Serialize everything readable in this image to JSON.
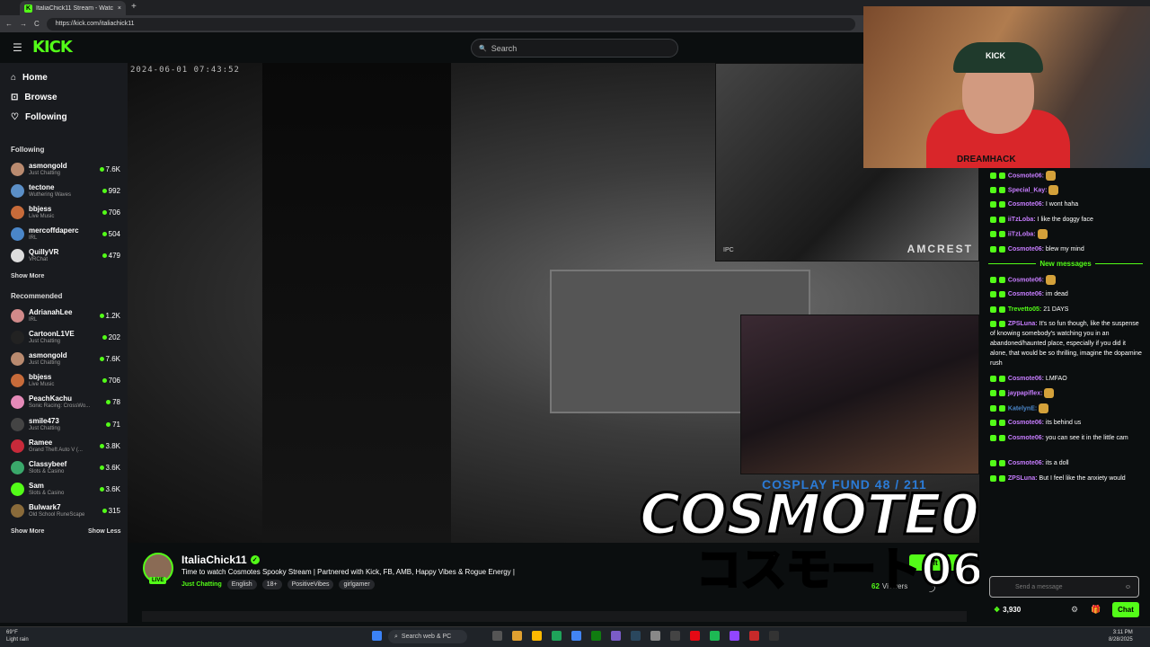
{
  "browser": {
    "tab_title": "ItaliaChick11 Stream - Watc",
    "tab_icon": "K",
    "close": "×",
    "new_tab": "+",
    "back": "←",
    "forward": "→",
    "reload": "C",
    "url": "https://kick.com/italiachick11"
  },
  "header": {
    "logo": "KICK",
    "menu_icon": "☰",
    "search_placeholder": "Search",
    "search_icon": "🔍"
  },
  "sidebar": {
    "nav": [
      {
        "label": "Home",
        "icon": "⌂"
      },
      {
        "label": "Browse",
        "icon": "⊡"
      },
      {
        "label": "Following",
        "icon": "♡"
      }
    ],
    "following_title": "Following",
    "following": [
      {
        "name": "asmongold",
        "category": "Just Chatting",
        "viewers": "7.6K",
        "color": "#b98a6f"
      },
      {
        "name": "tectone",
        "category": "Wuthering Waves",
        "viewers": "992",
        "color": "#5b8fc7"
      },
      {
        "name": "bbjess",
        "category": "Live Music",
        "viewers": "706",
        "color": "#c76b3a"
      },
      {
        "name": "mercoffdaperc",
        "category": "IRL",
        "viewers": "504",
        "color": "#4a86c9"
      },
      {
        "name": "QuillyVR",
        "category": "VRChat",
        "viewers": "479",
        "color": "#dddddd"
      }
    ],
    "show_more_1": "Show More",
    "recommended_title": "Recommended",
    "recommended": [
      {
        "name": "AdrianahLee",
        "category": "IRL",
        "viewers": "1.2K",
        "color": "#d18a8a"
      },
      {
        "name": "CartoonL1VE",
        "category": "Just Chatting",
        "viewers": "202",
        "color": "#222222"
      },
      {
        "name": "asmongold",
        "category": "Just Chatting",
        "viewers": "7.6K",
        "color": "#b98a6f"
      },
      {
        "name": "bbjess",
        "category": "Live Music",
        "viewers": "706",
        "color": "#c76b3a"
      },
      {
        "name": "PeachKachu",
        "category": "Sonic Racing: CrossWo...",
        "viewers": "78",
        "color": "#e48ab8"
      },
      {
        "name": "smile473",
        "category": "Just Chatting",
        "viewers": "71",
        "color": "#444444"
      },
      {
        "name": "Ramee",
        "category": "Grand Theft Auto V (...",
        "viewers": "3.8K",
        "color": "#c72a3a"
      },
      {
        "name": "Classybeef",
        "category": "Slots & Casino",
        "viewers": "3.6K",
        "color": "#3aa86b"
      },
      {
        "name": "Sam",
        "category": "Slots & Casino",
        "viewers": "3.6K",
        "color": "#53fc18"
      },
      {
        "name": "Bulwark7",
        "category": "Old School RuneScape",
        "viewers": "315",
        "color": "#8a6b3a"
      }
    ],
    "show_more_2": "Show More",
    "show_less": "Show Less"
  },
  "video": {
    "timestamp": "2024-06-01    07:43:52",
    "pip_brand": "AMCREST",
    "pip_ip": "IPC",
    "fund": "COSPLAY FUND  48 / 211",
    "overlay_main": "COSMOTE06",
    "overlay_jp": "コスモート06",
    "webcam_cap": "KICK",
    "webcam_shirt": "DREAMHACK"
  },
  "stream": {
    "channel": "ItaliaChick11",
    "verified": "✓",
    "live": "LIVE",
    "title": "Time to watch Cosmotes Spooky Stream | Partnered with Kick, FB, AMB, Happy Vibes & Rogue Energy |",
    "category": "Just Chatting",
    "tags": [
      "English",
      "18+",
      "PositiveVibes",
      "girlgamer"
    ],
    "viewers_count": "62",
    "viewers_label": "Viewers",
    "gift": "Gift Su",
    "share_icon": "⤴"
  },
  "chat": {
    "messages": [
      {
        "user": "Cosmote06",
        "text": "",
        "color": "#c77dff",
        "emote": true
      },
      {
        "user": "Special_Kay",
        "text": "",
        "color": "#c77dff",
        "emote": true
      },
      {
        "user": "Cosmote06",
        "text": "I wont haha",
        "color": "#c77dff",
        "emote": false
      },
      {
        "user": "iiTzLoba",
        "text": "I like the doggy face",
        "color": "#c77dff",
        "emote": false
      },
      {
        "user": "iiTzLoba",
        "text": "",
        "color": "#c77dff",
        "emote": true
      },
      {
        "user": "Cosmote06",
        "text": "blew my mind",
        "color": "#c77dff",
        "emote": false
      }
    ],
    "new_messages": "New messages",
    "messages2": [
      {
        "user": "Cosmote06",
        "text": "",
        "color": "#c77dff",
        "emote": true
      },
      {
        "user": "Cosmote06",
        "text": "im dead",
        "color": "#c77dff",
        "emote": false
      },
      {
        "user": "Trevetto05",
        "text": "21 DAYS",
        "color": "#53fc18",
        "emote": false
      },
      {
        "user": "ZPSLuna",
        "text": "It's so fun though, like the suspense of knowing somebody's watching you in an abandoned/haunted place, especially if you did it alone, that would be so thrilling, imagine the dopamine rush",
        "color": "#c77dff",
        "emote": false
      },
      {
        "user": "Cosmote06",
        "text": "LMFAO",
        "color": "#c77dff",
        "emote": false
      },
      {
        "user": "jaypapiflex",
        "text": "",
        "color": "#c77dff",
        "emote": true
      },
      {
        "user": "KatelynE",
        "text": "",
        "color": "#4a86c9",
        "emote": true
      },
      {
        "user": "Cosmote06",
        "text": "its behind us",
        "color": "#c77dff",
        "emote": false
      },
      {
        "user": "Cosmote06",
        "text": "you can see it in the little cam",
        "color": "#c77dff",
        "emote": false
      },
      {
        "user": "Cosmote06",
        "text": "its a doll",
        "color": "#c77dff",
        "emote": false
      },
      {
        "user": "ZPSLuna",
        "text": "But I feel like the anxiety would",
        "color": "#c77dff",
        "emote": false
      }
    ],
    "input_placeholder": "Send a message",
    "points": "3,930",
    "send": "Chat",
    "settings_icon": "⚙",
    "gift_icon": "🎁",
    "smile_icon": "☺"
  },
  "taskbar": {
    "temp": "69°F",
    "weather": "Light rain",
    "search": "Search web & PC",
    "time": "3:11 PM",
    "date": "8/28/2025"
  }
}
